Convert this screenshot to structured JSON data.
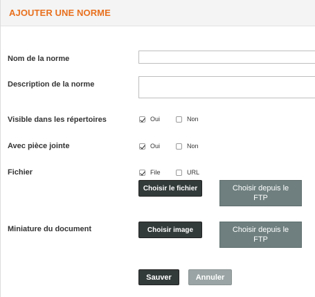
{
  "header": {
    "title": "AJOUTER UNE NORME"
  },
  "form": {
    "name": {
      "label": "Nom de la norme",
      "value": ""
    },
    "description": {
      "label": "Description de la norme",
      "value": ""
    },
    "visible": {
      "label": "Visible dans les répertoires",
      "opt1": "Oui",
      "opt1_checked": true,
      "opt2": "Non",
      "opt2_checked": false
    },
    "attachment": {
      "label": "Avec pièce jointe",
      "opt1": "Oui",
      "opt1_checked": true,
      "opt2": "Non",
      "opt2_checked": false
    },
    "file": {
      "label": "Fichier",
      "opt1": "File",
      "opt1_checked": true,
      "opt2": "URL",
      "opt2_checked": false,
      "choose_button": "Choisir le fichier",
      "ftp_button": "Choisir depuis le FTP"
    },
    "thumbnail": {
      "label": "Miniature du document",
      "choose_button": "Choisir image",
      "ftp_button": "Choisir depuis le FTP"
    }
  },
  "actions": {
    "save": "Sauver",
    "cancel": "Annuler"
  }
}
